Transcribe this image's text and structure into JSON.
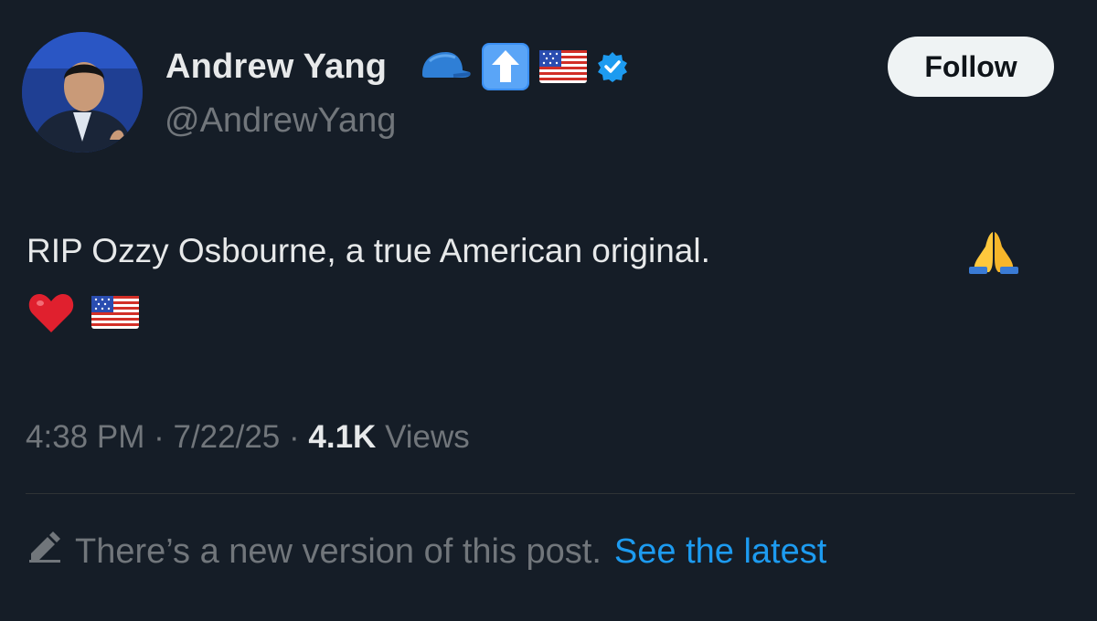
{
  "author": {
    "display_name": "Andrew Yang",
    "handle": "@AndrewYang",
    "badges": [
      "cap-emoji-icon",
      "up-arrow-emoji-icon",
      "us-flag-emoji-icon",
      "verified-badge-icon"
    ],
    "verified_color": "#1d9bf0"
  },
  "follow_button": {
    "label": "Follow"
  },
  "post": {
    "text": "RIP Ozzy Osbourne, a true American original.",
    "emojis_inline": [
      "praying-hands-emoji-icon"
    ],
    "emojis_line2": [
      "red-heart-emoji-icon",
      "us-flag-emoji-icon"
    ]
  },
  "meta": {
    "time": "4:38 PM",
    "separator": "·",
    "date": "7/22/25",
    "views_count": "4.1K",
    "views_label": "Views"
  },
  "notice": {
    "text": "There’s a new version of this post.",
    "link_label": "See the latest"
  },
  "colors": {
    "background": "#151d27",
    "primary_text": "#e7e9ea",
    "secondary_text": "#71767b",
    "link": "#1d9bf0",
    "follow_bg": "#eff3f4"
  }
}
